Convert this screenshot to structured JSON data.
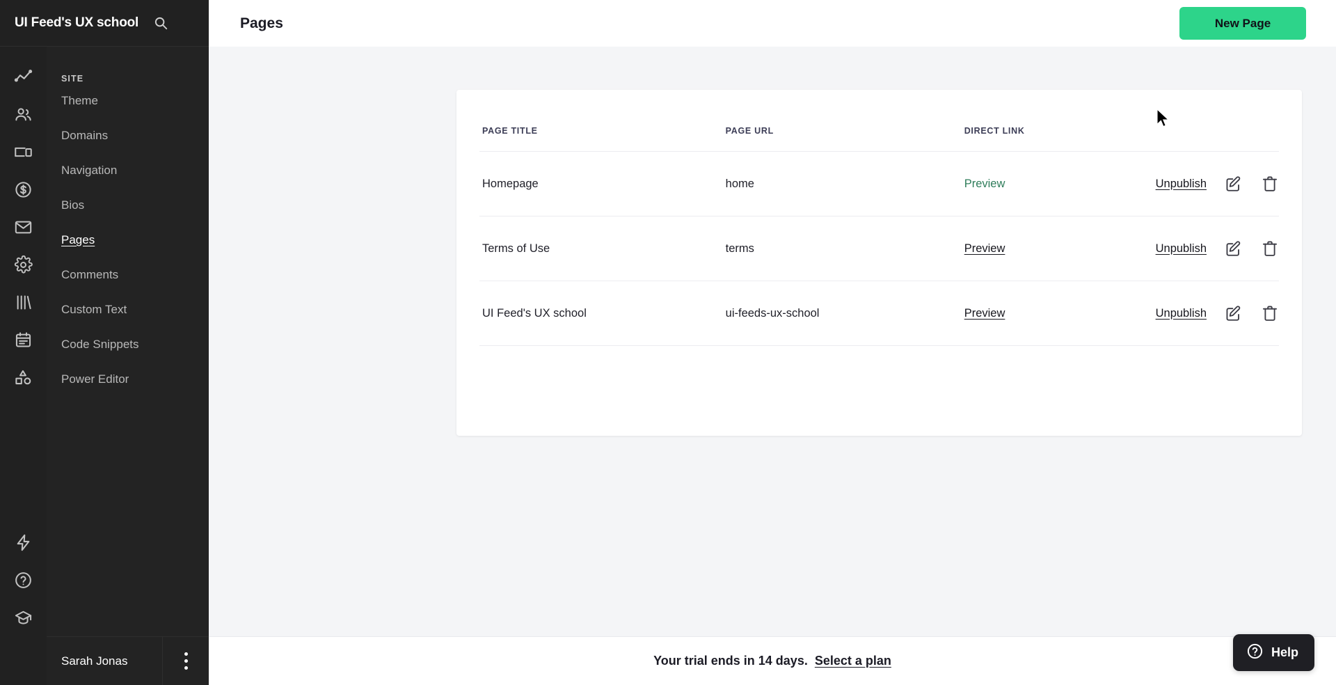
{
  "brand": {
    "title": "UI Feed's UX school",
    "search_icon": "search-icon"
  },
  "rail": {
    "icons": [
      {
        "name": "analytics-icon",
        "label": "Analytics"
      },
      {
        "name": "audience-icon",
        "label": "Audience"
      },
      {
        "name": "devices-icon",
        "label": "Site"
      },
      {
        "name": "revenue-icon",
        "label": "Revenue"
      },
      {
        "name": "email-icon",
        "label": "Email"
      },
      {
        "name": "settings-gear-icon",
        "label": "Settings"
      },
      {
        "name": "library-icon",
        "label": "Library"
      },
      {
        "name": "schedule-icon",
        "label": "Schedule"
      },
      {
        "name": "shapes-icon",
        "label": "Design"
      }
    ],
    "bottom_icons": [
      {
        "name": "lightning-icon",
        "label": "Automations"
      },
      {
        "name": "help-circle-icon",
        "label": "Help"
      },
      {
        "name": "graduation-cap-icon",
        "label": "Learn"
      }
    ]
  },
  "sidebar": {
    "section_label": "SITE",
    "items": [
      {
        "label": "Theme",
        "active": false
      },
      {
        "label": "Domains",
        "active": false
      },
      {
        "label": "Navigation",
        "active": false
      },
      {
        "label": "Bios",
        "active": false
      },
      {
        "label": "Pages",
        "active": true
      },
      {
        "label": "Comments",
        "active": false
      },
      {
        "label": "Custom Text",
        "active": false
      },
      {
        "label": "Code Snippets",
        "active": false
      },
      {
        "label": "Power Editor",
        "active": false
      }
    ],
    "user": {
      "name": "Sarah Jonas",
      "menu_icon": "kebab-menu-icon"
    }
  },
  "header": {
    "title": "Pages",
    "new_page_label": "New Page"
  },
  "table": {
    "columns": [
      "PAGE TITLE",
      "PAGE URL",
      "DIRECT LINK"
    ],
    "rows": [
      {
        "title": "Homepage",
        "url": "home",
        "link_label": "Preview",
        "link_underlined": false,
        "unpublish_label": "Unpublish",
        "edit_icon": "edit-icon",
        "delete_icon": "trash-icon"
      },
      {
        "title": "Terms of Use",
        "url": "terms",
        "link_label": "Preview",
        "link_underlined": true,
        "unpublish_label": "Unpublish",
        "edit_icon": "edit-icon",
        "delete_icon": "trash-icon"
      },
      {
        "title": "UI Feed's UX school",
        "url": "ui-feeds-ux-school",
        "link_label": "Preview",
        "link_underlined": true,
        "unpublish_label": "Unpublish",
        "edit_icon": "edit-icon",
        "delete_icon": "trash-icon"
      }
    ]
  },
  "banner": {
    "text": "Your trial ends in 14 days.",
    "link_label": "Select a plan"
  },
  "help": {
    "label": "Help",
    "icon": "help-circle-icon"
  },
  "colors": {
    "accent_green": "#2dd48a",
    "preview_green": "#2f7d5b",
    "rail_bg": "#212121",
    "sidebar_bg": "#232323",
    "canvas_bg": "#f4f5f7"
  }
}
